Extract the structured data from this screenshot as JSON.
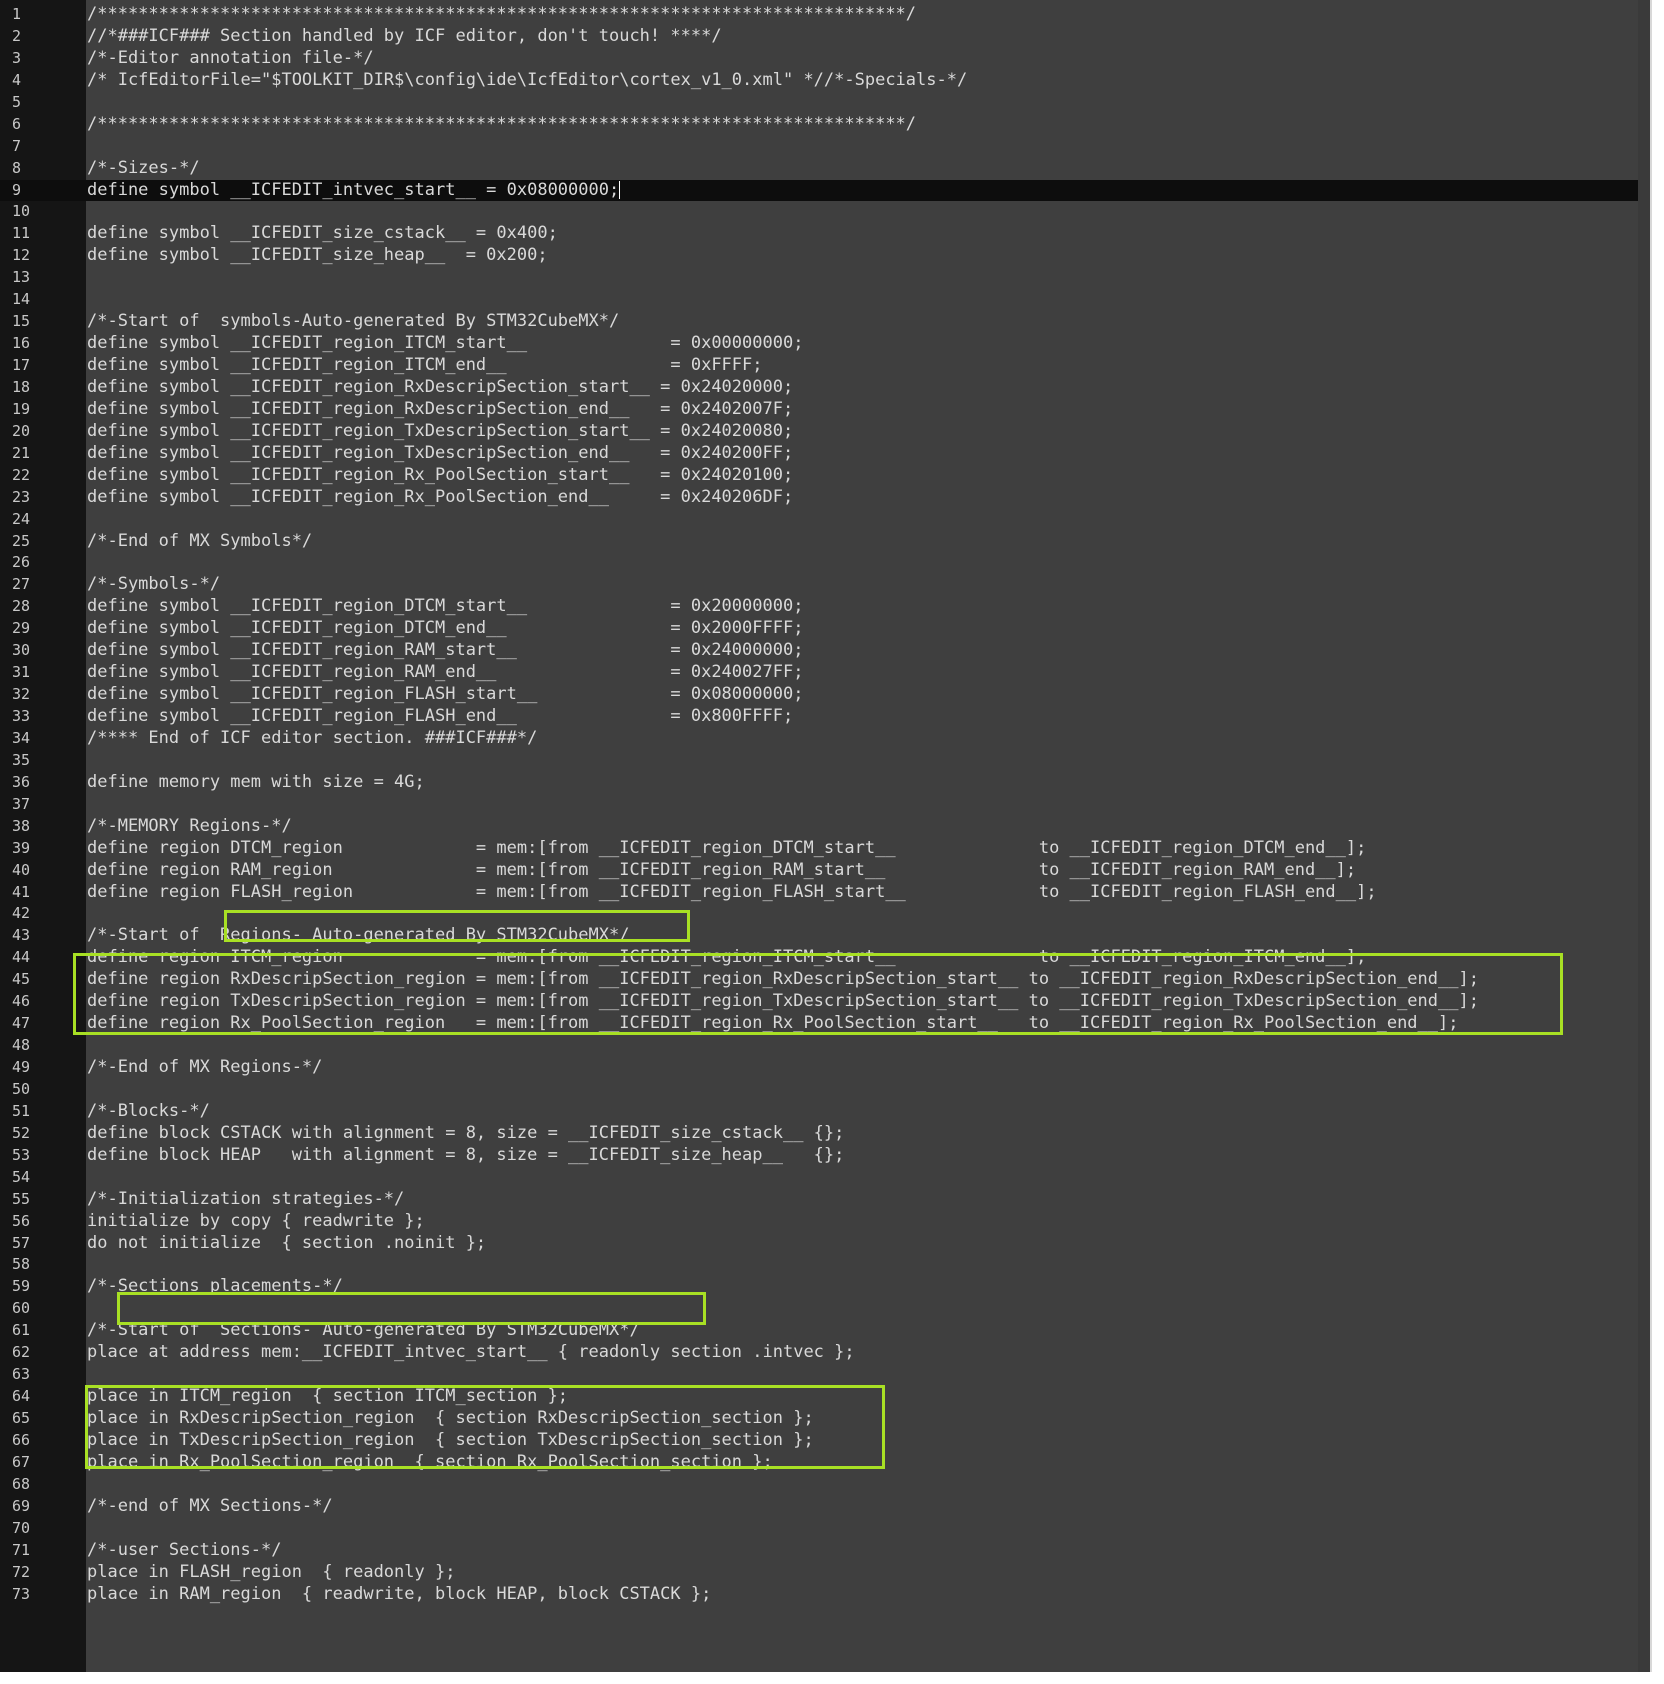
{
  "editor": {
    "highlight_color": "#a8e024",
    "background": "#3f3f3f",
    "gutter_background": "#151515",
    "current_line": 9,
    "lines": [
      {
        "n": "1",
        "t": "/*******************************************************************************/"
      },
      {
        "n": "2",
        "t": "//*###ICF### Section handled by ICF editor, don't touch! ****/"
      },
      {
        "n": "3",
        "t": "/*-Editor annotation file-*/"
      },
      {
        "n": "4",
        "t": "/* IcfEditorFile=\"$TOOLKIT_DIR$\\config\\ide\\IcfEditor\\cortex_v1_0.xml\" *//*-Specials-*/"
      },
      {
        "n": "5",
        "t": ""
      },
      {
        "n": "6",
        "t": "/*******************************************************************************/"
      },
      {
        "n": "7",
        "t": ""
      },
      {
        "n": "8",
        "t": "/*-Sizes-*/"
      },
      {
        "n": "9",
        "t": "define symbol __ICFEDIT_intvec_start__ = 0x08000000;"
      },
      {
        "n": "10",
        "t": ""
      },
      {
        "n": "11",
        "t": "define symbol __ICFEDIT_size_cstack__ = 0x400;"
      },
      {
        "n": "12",
        "t": "define symbol __ICFEDIT_size_heap__  = 0x200;"
      },
      {
        "n": "13",
        "t": ""
      },
      {
        "n": "14",
        "t": ""
      },
      {
        "n": "15",
        "t": "/*-Start of  symbols-Auto-generated By STM32CubeMX*/"
      },
      {
        "n": "16",
        "t": "define symbol __ICFEDIT_region_ITCM_start__              = 0x00000000;"
      },
      {
        "n": "17",
        "t": "define symbol __ICFEDIT_region_ITCM_end__                = 0xFFFF;"
      },
      {
        "n": "18",
        "t": "define symbol __ICFEDIT_region_RxDescripSection_start__ = 0x24020000;"
      },
      {
        "n": "19",
        "t": "define symbol __ICFEDIT_region_RxDescripSection_end__   = 0x2402007F;"
      },
      {
        "n": "20",
        "t": "define symbol __ICFEDIT_region_TxDescripSection_start__ = 0x24020080;"
      },
      {
        "n": "21",
        "t": "define symbol __ICFEDIT_region_TxDescripSection_end__   = 0x240200FF;"
      },
      {
        "n": "22",
        "t": "define symbol __ICFEDIT_region_Rx_PoolSection_start__   = 0x24020100;"
      },
      {
        "n": "23",
        "t": "define symbol __ICFEDIT_region_Rx_PoolSection_end__     = 0x240206DF;"
      },
      {
        "n": "24",
        "t": ""
      },
      {
        "n": "25",
        "t": "/*-End of MX Symbols*/"
      },
      {
        "n": "26",
        "t": ""
      },
      {
        "n": "27",
        "t": "/*-Symbols-*/"
      },
      {
        "n": "28",
        "t": "define symbol __ICFEDIT_region_DTCM_start__              = 0x20000000;"
      },
      {
        "n": "29",
        "t": "define symbol __ICFEDIT_region_DTCM_end__                = 0x2000FFFF;"
      },
      {
        "n": "30",
        "t": "define symbol __ICFEDIT_region_RAM_start__               = 0x24000000;"
      },
      {
        "n": "31",
        "t": "define symbol __ICFEDIT_region_RAM_end__                 = 0x240027FF;"
      },
      {
        "n": "32",
        "t": "define symbol __ICFEDIT_region_FLASH_start__             = 0x08000000;"
      },
      {
        "n": "33",
        "t": "define symbol __ICFEDIT_region_FLASH_end__               = 0x800FFFF;"
      },
      {
        "n": "34",
        "t": "/**** End of ICF editor section. ###ICF###*/"
      },
      {
        "n": "35",
        "t": ""
      },
      {
        "n": "36",
        "t": "define memory mem with size = 4G;"
      },
      {
        "n": "37",
        "t": ""
      },
      {
        "n": "38",
        "t": "/*-MEMORY Regions-*/"
      },
      {
        "n": "39",
        "t": "define region DTCM_region             = mem:[from __ICFEDIT_region_DTCM_start__              to __ICFEDIT_region_DTCM_end__];"
      },
      {
        "n": "40",
        "t": "define region RAM_region              = mem:[from __ICFEDIT_region_RAM_start__               to __ICFEDIT_region_RAM_end__];"
      },
      {
        "n": "41",
        "t": "define region FLASH_region            = mem:[from __ICFEDIT_region_FLASH_start__             to __ICFEDIT_region_FLASH_end__];"
      },
      {
        "n": "42",
        "t": ""
      },
      {
        "n": "43",
        "t": "/*-Start of  Regions- Auto-generated By STM32CubeMX*/"
      },
      {
        "n": "44",
        "t": "define region ITCM_region             = mem:[from __ICFEDIT_region_ITCM_start__              to __ICFEDIT_region_ITCM_end__];"
      },
      {
        "n": "45",
        "t": "define region RxDescripSection_region = mem:[from __ICFEDIT_region_RxDescripSection_start__ to __ICFEDIT_region_RxDescripSection_end__];"
      },
      {
        "n": "46",
        "t": "define region TxDescripSection_region = mem:[from __ICFEDIT_region_TxDescripSection_start__ to __ICFEDIT_region_TxDescripSection_end__];"
      },
      {
        "n": "47",
        "t": "define region Rx_PoolSection_region   = mem:[from __ICFEDIT_region_Rx_PoolSection_start__   to __ICFEDIT_region_Rx_PoolSection_end__];"
      },
      {
        "n": "48",
        "t": ""
      },
      {
        "n": "49",
        "t": "/*-End of MX Regions-*/"
      },
      {
        "n": "50",
        "t": ""
      },
      {
        "n": "51",
        "t": "/*-Blocks-*/"
      },
      {
        "n": "52",
        "t": "define block CSTACK with alignment = 8, size = __ICFEDIT_size_cstack__ {};"
      },
      {
        "n": "53",
        "t": "define block HEAP   with alignment = 8, size = __ICFEDIT_size_heap__   {};"
      },
      {
        "n": "54",
        "t": ""
      },
      {
        "n": "55",
        "t": "/*-Initialization strategies-*/"
      },
      {
        "n": "56",
        "t": "initialize by copy { readwrite };"
      },
      {
        "n": "57",
        "t": "do not initialize  { section .noinit };"
      },
      {
        "n": "58",
        "t": ""
      },
      {
        "n": "59",
        "t": "/*-Sections placements-*/"
      },
      {
        "n": "60",
        "t": ""
      },
      {
        "n": "61",
        "t": "/*-Start of  Sections- Auto-generated By STM32CubeMX*/"
      },
      {
        "n": "62",
        "t": "place at address mem:__ICFEDIT_intvec_start__ { readonly section .intvec };"
      },
      {
        "n": "63",
        "t": ""
      },
      {
        "n": "64",
        "t": "place in ITCM_region  { section ITCM_section };"
      },
      {
        "n": "65",
        "t": "place in RxDescripSection_region  { section RxDescripSection_section };"
      },
      {
        "n": "66",
        "t": "place in TxDescripSection_region  { section TxDescripSection_section };"
      },
      {
        "n": "67",
        "t": "place in Rx_PoolSection_region  { section Rx_PoolSection_section };"
      },
      {
        "n": "68",
        "t": ""
      },
      {
        "n": "69",
        "t": "/*-end of MX Sections-*/"
      },
      {
        "n": "70",
        "t": ""
      },
      {
        "n": "71",
        "t": "/*-user Sections-*/"
      },
      {
        "n": "72",
        "t": "place in FLASH_region  { readonly };"
      },
      {
        "n": "73",
        "t": "place in RAM_region  { readwrite, block HEAP, block CSTACK };"
      }
    ]
  }
}
